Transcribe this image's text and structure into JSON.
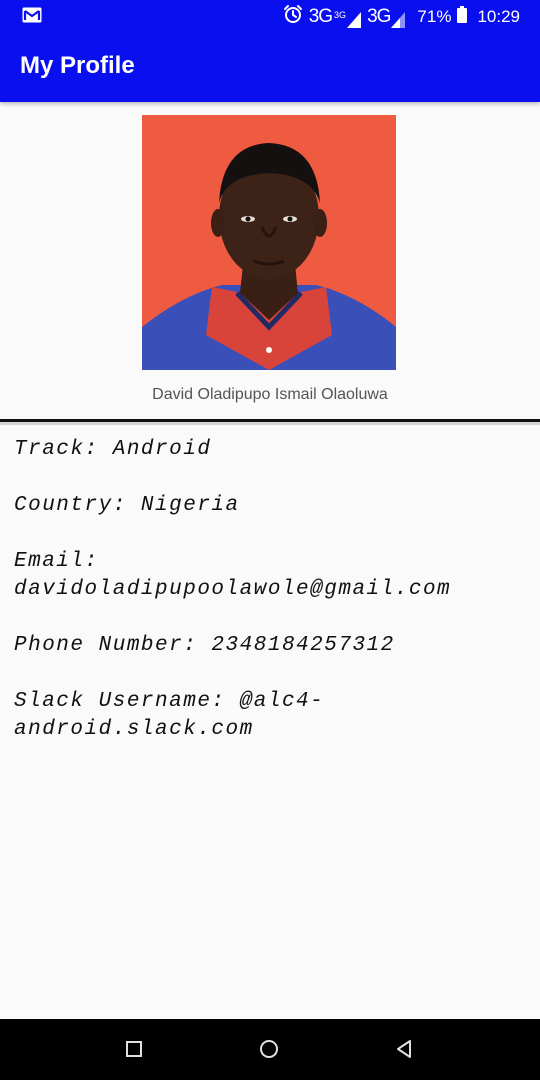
{
  "status_bar": {
    "left_icons": [
      "gmail-icon"
    ],
    "alarm_icon": "alarm-icon",
    "network1": "3G",
    "network1_sup": "3G",
    "network2": "3G",
    "battery": "71%",
    "battery_icon": "battery-icon",
    "time": "10:29",
    "background": "#0a0ff0"
  },
  "app_bar": {
    "title": "My Profile",
    "background": "#0a0ff0"
  },
  "profile": {
    "photo": "profile-photo",
    "name": "David Oladipupo Ismail Olaoluwa"
  },
  "details": {
    "track": "Track: Android",
    "country": "Country: Nigeria",
    "email": "Email: davidoladipupoolawole@gmail.com",
    "phone": "Phone Number: 2348184257312",
    "slack": "Slack Username: @alc4-android.slack.com"
  },
  "nav_bar": {
    "buttons": [
      "recents-button",
      "home-button",
      "back-button"
    ]
  }
}
